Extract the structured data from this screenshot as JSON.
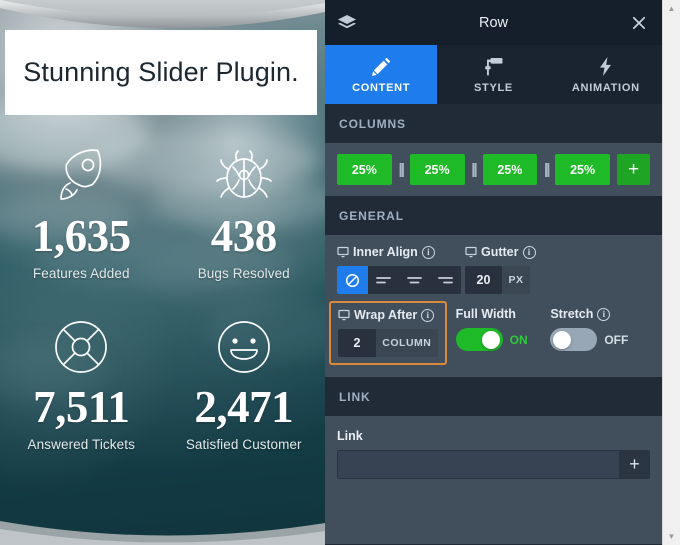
{
  "slider": {
    "headline": "Stunning Slider Plugin.",
    "stats": [
      {
        "icon": "rocket-icon",
        "value": "1,635",
        "label": "Features Added"
      },
      {
        "icon": "bug-icon",
        "value": "438",
        "label": "Bugs Resolved"
      },
      {
        "icon": "lifebuoy-icon",
        "value": "7,511",
        "label": "Answered Tickets"
      },
      {
        "icon": "smiley-icon",
        "value": "2,471",
        "label": "Satisfied Customer"
      }
    ]
  },
  "panel": {
    "title": "Row",
    "layers_icon": "layers-icon",
    "close_icon": "close-icon",
    "tabs": [
      {
        "label": "CONTENT",
        "icon": "pencil-icon",
        "active": true
      },
      {
        "label": "STYLE",
        "icon": "paint-roller-icon",
        "active": false
      },
      {
        "label": "ANIMATION",
        "icon": "lightning-bolt-icon",
        "active": false
      }
    ],
    "columns": {
      "heading": "COLUMNS",
      "chips": [
        "25%",
        "25%",
        "25%",
        "25%"
      ],
      "add_label": "+"
    },
    "general": {
      "heading": "GENERAL",
      "inner_align": {
        "label": "Inner Align",
        "info": "i",
        "options": [
          "none-icon",
          "align-left-icon",
          "align-center-icon",
          "align-right-icon"
        ],
        "active_index": 0
      },
      "gutter": {
        "label": "Gutter",
        "info": "i",
        "value": "20",
        "unit": "PX"
      },
      "wrap_after": {
        "label": "Wrap After",
        "info": "i",
        "value": "2",
        "unit": "COLUMN",
        "highlighted": true,
        "highlight_color": "#d98a3c"
      },
      "full_width": {
        "label": "Full Width",
        "state": "ON",
        "on": true
      },
      "stretch": {
        "label": "Stretch",
        "info": "i",
        "state": "OFF",
        "on": false
      }
    },
    "link": {
      "heading": "LINK",
      "label": "Link",
      "value": "",
      "placeholder": "",
      "add_label": "+"
    },
    "colors": {
      "accent_blue": "#1f7ced",
      "green": "#1eba27",
      "panel_dark": "#212b38",
      "panel_body": "#414f5d",
      "highlight_orange": "#d98a3c"
    }
  },
  "scrollbar": {
    "up_arrow": "▲",
    "down_arrow": "▼"
  }
}
